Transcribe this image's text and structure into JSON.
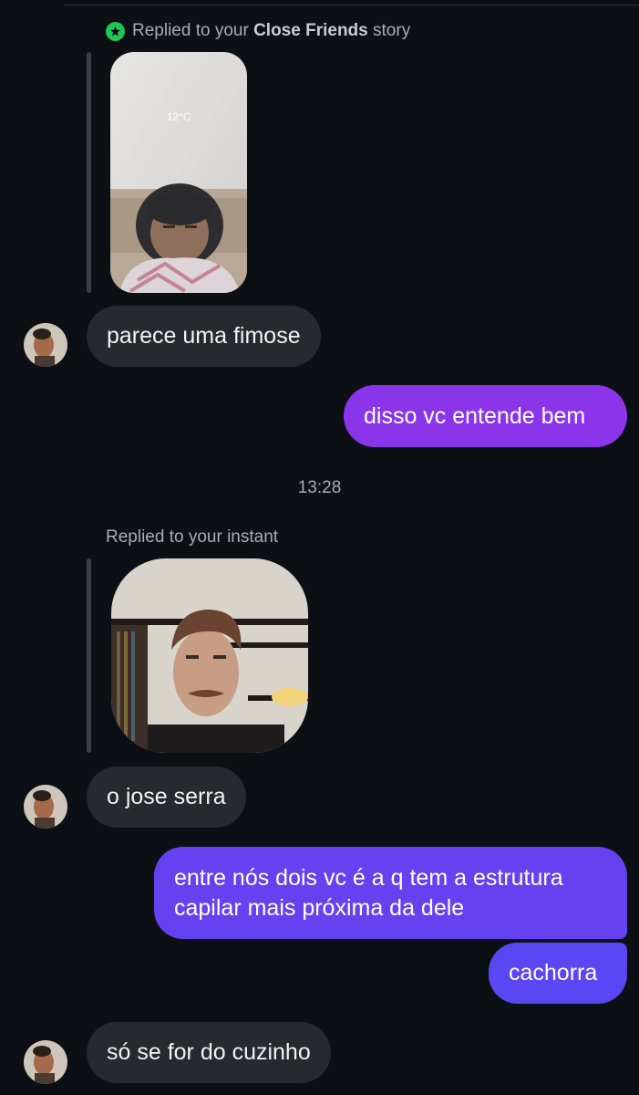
{
  "story_reply": {
    "prefix": "Replied to your",
    "emphasis": "Close Friends",
    "suffix": "story",
    "temperature": "12°C",
    "icon": "close-friends-star-icon",
    "icon_color": "#1fc555"
  },
  "messages": [
    {
      "direction": "incoming",
      "text": "parece uma fimose"
    },
    {
      "direction": "outgoing",
      "text": "disso vc entende bem"
    },
    {
      "direction": "incoming",
      "text": "o jose serra"
    },
    {
      "direction": "outgoing",
      "lines": [
        "entre nós dois vc é a q tem a estrutura",
        "capilar mais próxima da dele"
      ]
    },
    {
      "direction": "outgoing",
      "text": "cachorra"
    },
    {
      "direction": "incoming",
      "text": "só se for do cuzinho"
    }
  ],
  "timestamp": "13:28",
  "instant_reply": {
    "label": "Replied to your instant"
  },
  "colors": {
    "background": "#0c1014",
    "incoming_bubble": "#262a2f",
    "outgoing_gradient_top": "#8a3ae8",
    "outgoing_gradient_bottom": "#5b43f0"
  }
}
